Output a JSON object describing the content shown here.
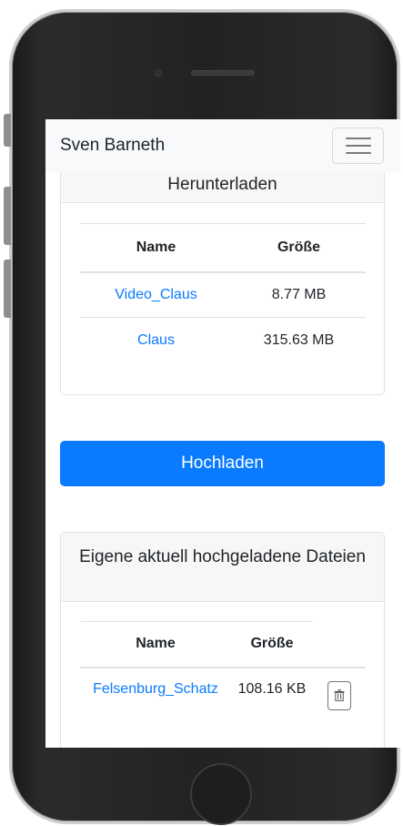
{
  "navbar": {
    "brand": "Sven Barneth",
    "toggler_icon": "hamburger-menu-icon"
  },
  "downloads": {
    "title": "Herunterladen",
    "columns": [
      "Name",
      "Größe"
    ],
    "rows": [
      {
        "name": "Video_Claus",
        "size": "8.77 MB"
      },
      {
        "name": "Claus",
        "size": "315.63 MB"
      }
    ]
  },
  "upload": {
    "label": "Hochladen"
  },
  "own_uploads": {
    "title": "Eigene aktuell hochgeladene Dateien",
    "columns": [
      "Name",
      "Größe"
    ],
    "rows": [
      {
        "name": "Felsenburg_Schatz",
        "size": "108.16 KB",
        "action_icon": "trash-icon"
      }
    ]
  },
  "colors": {
    "primary": "#0a7bff",
    "navbar_bg": "#f8f9fa",
    "card_header_bg": "#f7f7f7"
  }
}
